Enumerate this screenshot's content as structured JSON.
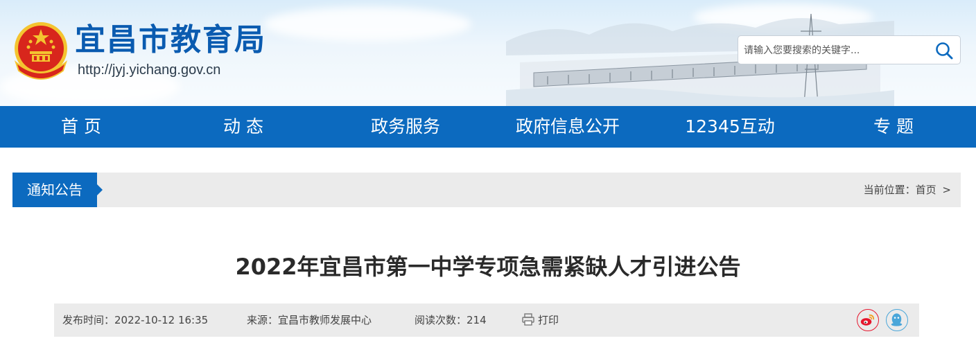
{
  "header": {
    "site_title": "宜昌市教育局",
    "site_url": "http://jyj.yichang.gov.cn",
    "search_placeholder": "请输入您要搜索的关键字..."
  },
  "nav": {
    "items": [
      "首 页",
      "动 态",
      "政务服务",
      "政府信息公开",
      "12345互动",
      "专 题"
    ]
  },
  "section": {
    "tag": "通知公告",
    "crumb_label": "当前位置：",
    "crumb_home": "首页",
    "crumb_sep": ">"
  },
  "article": {
    "title": "2022年宜昌市第一中学专项急需紧缺人才引进公告",
    "publish_time": "发布时间：2022-10-12 16:35",
    "source": "来源：宜昌市教师发展中心",
    "read_count": "阅读次数：214",
    "print_label": "打印"
  },
  "icons": {
    "emblem": "national-emblem-icon",
    "search": "search-icon",
    "print": "printer-icon",
    "weibo": "weibo-icon",
    "qq": "qq-icon"
  },
  "colors": {
    "brand_blue": "#0c6abf",
    "title_blue": "#0a5bb0",
    "weibo": "#e6162d",
    "qq": "#4aa6d9"
  }
}
